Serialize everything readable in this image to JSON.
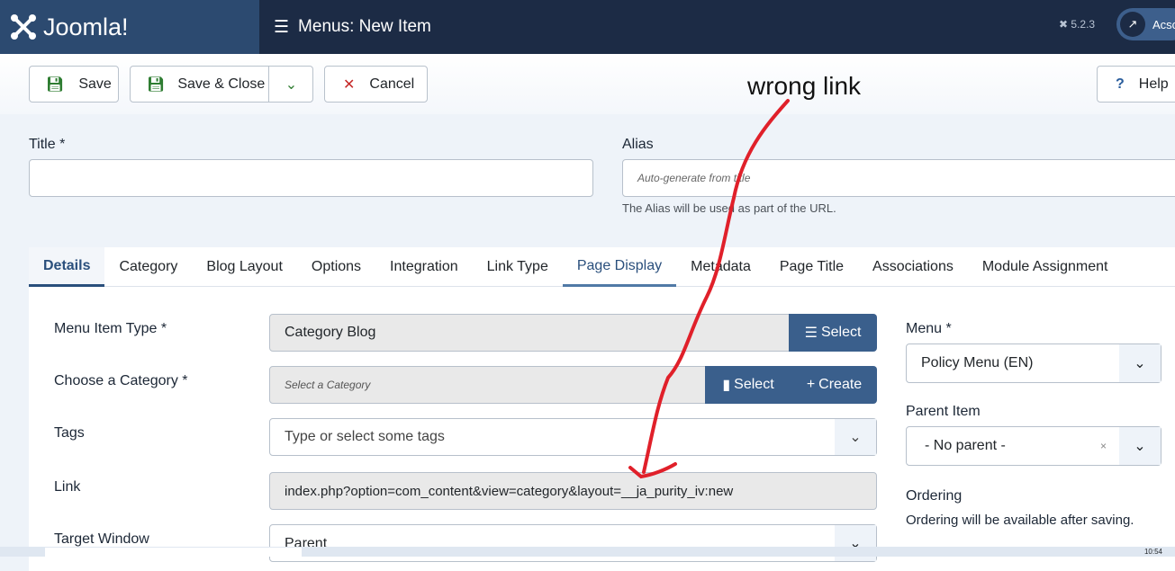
{
  "header": {
    "brand": "Joomla!",
    "title": "Menus: New Item",
    "version": "5.2.3",
    "account": "Acsc"
  },
  "toolbar": {
    "save": "Save",
    "save_close": "Save & Close",
    "cancel": "Cancel",
    "help": "Help"
  },
  "form": {
    "title_label": "Title *",
    "title_value": "",
    "alias_label": "Alias",
    "alias_placeholder": "Auto-generate from title",
    "alias_hint": "The Alias will be used as part of the URL."
  },
  "tabs": [
    "Details",
    "Category",
    "Blog Layout",
    "Options",
    "Integration",
    "Link Type",
    "Page Display",
    "Metadata",
    "Page Title",
    "Associations",
    "Module Assignment"
  ],
  "details": {
    "menu_item_type_label": "Menu Item Type *",
    "menu_item_type_value": "Category Blog",
    "select": "Select",
    "category_label": "Choose a Category *",
    "category_placeholder": "Select a Category",
    "create": "Create",
    "tags_label": "Tags",
    "tags_placeholder": "Type or select some tags",
    "link_label": "Link",
    "link_value": "index.php?option=com_content&view=category&layout=__ja_purity_iv:new",
    "target_label": "Target Window",
    "target_value": "Parent"
  },
  "side": {
    "menu_label": "Menu *",
    "menu_value": "Policy Menu (EN)",
    "parent_label": "Parent Item",
    "parent_value": "- No parent -",
    "ordering_label": "Ordering",
    "ordering_hint": "Ordering will be available after saving."
  },
  "annotation": {
    "text": "wrong link",
    "color": "#e0202a"
  },
  "taskbar": {
    "clock": "10:54"
  }
}
